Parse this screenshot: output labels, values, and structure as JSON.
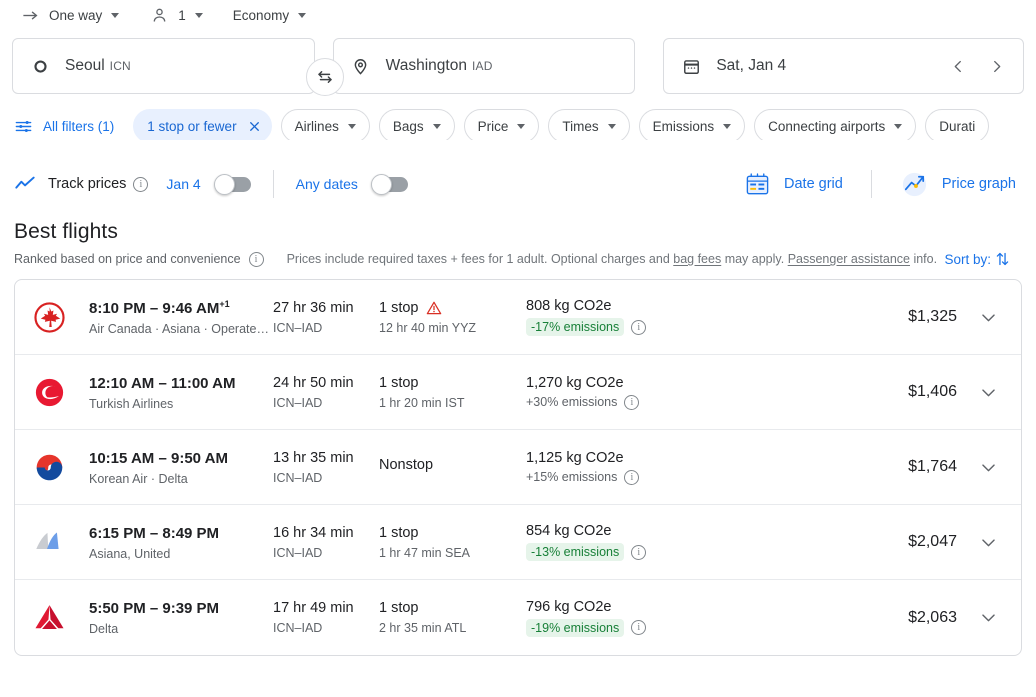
{
  "options_bar": {
    "trip_type": "One way",
    "passengers": "1",
    "cabin_class": "Economy"
  },
  "search": {
    "origin_city": "Seoul",
    "origin_code": "ICN",
    "destination_city": "Washington",
    "destination_code": "IAD",
    "date": "Sat, Jan 4"
  },
  "filters": {
    "all_filters_label": "All filters (1)",
    "chips": [
      {
        "label": "1 stop or fewer",
        "active": true,
        "removable": true
      },
      {
        "label": "Airlines",
        "active": false,
        "dropdown": true
      },
      {
        "label": "Bags",
        "active": false,
        "dropdown": true
      },
      {
        "label": "Price",
        "active": false,
        "dropdown": true
      },
      {
        "label": "Times",
        "active": false,
        "dropdown": true
      },
      {
        "label": "Emissions",
        "active": false,
        "dropdown": true
      },
      {
        "label": "Connecting airports",
        "active": false,
        "dropdown": true
      },
      {
        "label": "Durati",
        "active": false,
        "dropdown": false
      }
    ]
  },
  "track": {
    "label": "Track prices",
    "date_label": "Jan 4",
    "date_toggle_on": false,
    "any_dates_label": "Any dates",
    "any_dates_toggle_on": false,
    "date_grid_label": "Date grid",
    "price_graph_label": "Price graph"
  },
  "section": {
    "title": "Best flights",
    "ranked_note": "Ranked based on price and convenience",
    "disclaimer_a": "Prices include required taxes + fees for 1 adult. Optional charges and ",
    "disclaimer_link1": "bag fees",
    "disclaimer_b": " may apply. ",
    "disclaimer_link2": "Passenger assistance",
    "disclaimer_c": " info.",
    "sort_by_label": "Sort by:"
  },
  "flights": [
    {
      "logo": "air-canada-logo",
      "times": "8:10 PM – 9:46 AM",
      "day_offset": "+1",
      "airlines": "Air Canada · Asiana · Operated by Air Canada Exp…",
      "duration": "27 hr 36 min",
      "route": "ICN–IAD",
      "stops": "1 stop",
      "warning": true,
      "stop_detail": "12 hr 40 min YYZ",
      "emissions": "808 kg CO2e",
      "emissions_delta": "-17% emissions",
      "emissions_badge": true,
      "price": "$1,325"
    },
    {
      "logo": "turkish-airlines-logo",
      "times": "12:10 AM – 11:00 AM",
      "day_offset": "",
      "airlines": "Turkish Airlines",
      "duration": "24 hr 50 min",
      "route": "ICN–IAD",
      "stops": "1 stop",
      "warning": false,
      "stop_detail": "1 hr 20 min IST",
      "emissions": "1,270 kg CO2e",
      "emissions_delta": "+30% emissions",
      "emissions_badge": false,
      "price": "$1,406"
    },
    {
      "logo": "korean-air-logo",
      "times": "10:15 AM – 9:50 AM",
      "day_offset": "",
      "airlines": "Korean Air · Delta",
      "duration": "13 hr 35 min",
      "route": "ICN–IAD",
      "stops": "Nonstop",
      "warning": false,
      "stop_detail": "",
      "emissions": "1,125 kg CO2e",
      "emissions_delta": "+15% emissions",
      "emissions_badge": false,
      "price": "$1,764"
    },
    {
      "logo": "asiana-airlines-logo",
      "times": "6:15 PM – 8:49 PM",
      "day_offset": "",
      "airlines": "Asiana, United",
      "duration": "16 hr 34 min",
      "route": "ICN–IAD",
      "stops": "1 stop",
      "warning": false,
      "stop_detail": "1 hr 47 min SEA",
      "emissions": "854 kg CO2e",
      "emissions_delta": "-13% emissions",
      "emissions_badge": true,
      "price": "$2,047"
    },
    {
      "logo": "delta-logo",
      "times": "5:50 PM – 9:39 PM",
      "day_offset": "",
      "airlines": "Delta",
      "duration": "17 hr 49 min",
      "route": "ICN–IAD",
      "stops": "1 stop",
      "warning": false,
      "stop_detail": "2 hr 35 min ATL",
      "emissions": "796 kg CO2e",
      "emissions_delta": "-19% emissions",
      "emissions_badge": true,
      "price": "$2,063"
    }
  ],
  "colors": {
    "accent_blue": "#1a73e8",
    "chip_active_bg": "#e8f0fe",
    "eco_green": "#188038",
    "eco_green_bg": "#e6f4ea",
    "warning_red": "#d93025"
  }
}
